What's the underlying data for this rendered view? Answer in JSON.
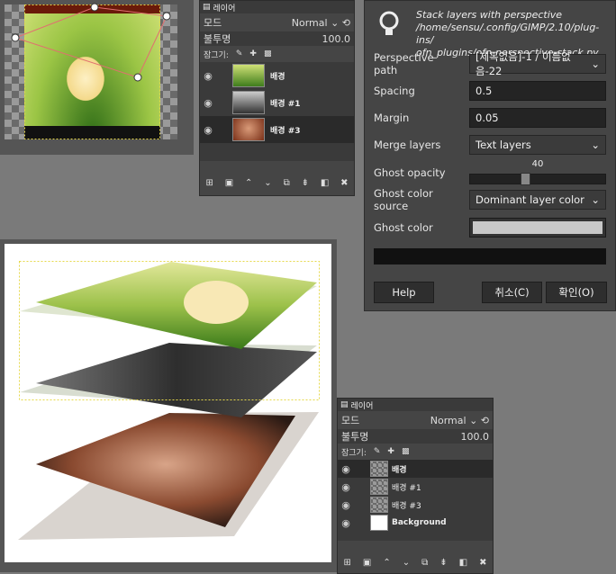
{
  "layers_panel": {
    "tab_label": "레이어",
    "mode_label": "모드",
    "mode_value": "Normal",
    "opacity_label": "불투명",
    "opacity_value": "100.0",
    "lock_label": "잠그기:",
    "layers": [
      {
        "name": "배경"
      },
      {
        "name": "배경 #1"
      },
      {
        "name": "배경 #3"
      }
    ]
  },
  "layers_panel2": {
    "tab_label": "레이어",
    "mode_label": "모드",
    "mode_value": "Normal",
    "opacity_label": "불투명",
    "opacity_value": "100.0",
    "lock_label": "잠그기:",
    "layers": [
      {
        "name": "배경"
      },
      {
        "name": "배경 #1"
      },
      {
        "name": "배경 #3"
      },
      {
        "name": "Background"
      }
    ]
  },
  "dialog": {
    "title_line1": "Stack layers with perspective",
    "title_line2": "/home/sensu/.config/GIMP/2.10/plug-ins/",
    "title_line3": "ofn_plugins/ofn-perspective-stack.py",
    "perspective_path_label": "Perspective path",
    "perspective_path_value": "[제목없음]-1 / 이름없음-22",
    "spacing_label": "Spacing",
    "spacing_value": "0.5",
    "margin_label": "Margin",
    "margin_value": "0.05",
    "merge_layers_label": "Merge layers",
    "merge_layers_value": "Text layers",
    "ghost_opacity_label": "Ghost opacity",
    "ghost_opacity_value": "40",
    "ghost_opacity_fraction": 0.4,
    "ghost_color_source_label": "Ghost color source",
    "ghost_color_source_value": "Dominant layer color",
    "ghost_color_label": "Ghost color",
    "ghost_color_swatch": "#c8c8c8",
    "help_button": "Help",
    "cancel_button": "취소(C)",
    "ok_button": "확인(O)"
  },
  "colors": {
    "accent_path": "#e07070",
    "selection_dash": "#e6d84a"
  }
}
